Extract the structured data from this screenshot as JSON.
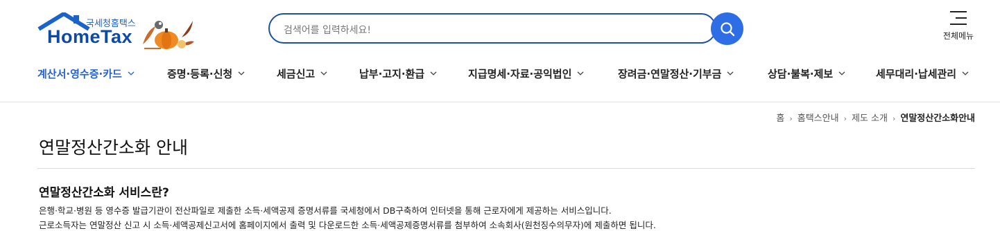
{
  "logo": {
    "subtitle": "국세청홈택스",
    "title": "HomeTax"
  },
  "search": {
    "placeholder": "검색어를 입력하세요!"
  },
  "menu_all": {
    "label": "전체메뉴"
  },
  "gnb": [
    {
      "label": "계산서·영수증·카드",
      "active": true
    },
    {
      "label": "증명·등록·신청"
    },
    {
      "label": "세금신고"
    },
    {
      "label": "납부·고지·환급"
    },
    {
      "label": "지급명세·자료·공익법인"
    },
    {
      "label": "장려금·연말정산·기부금"
    },
    {
      "label": "상담·불복·제보"
    },
    {
      "label": "세무대리·납세관리"
    }
  ],
  "breadcrumb": [
    "홈",
    "홈택스안내",
    "제도 소개",
    "연말정산간소화안내"
  ],
  "page_title": "연말정산간소화 안내",
  "section": {
    "title": "연말정산간소화 서비스란?",
    "lines": [
      "은행·학교·병원 등 영수증 발급기관이 전산파일로 제출한 소득·세액공제 증명서류를 국세청에서 DB구축하여 인터넷을 통해 근로자에게 제공하는 서비스입니다.",
      "근로소득자는 연말정산 신고 시 소득·세액공제신고서에 홈페이지에서 출력 및 다운로드한 소득·세액공제증명서류를 첨부하여 소속회사(원천징수의무자)에 제출하면 됩니다."
    ]
  },
  "colors": {
    "brand": "#0d4aa8",
    "accent": "#2d6ee6",
    "active_menu": "#2163d6"
  }
}
